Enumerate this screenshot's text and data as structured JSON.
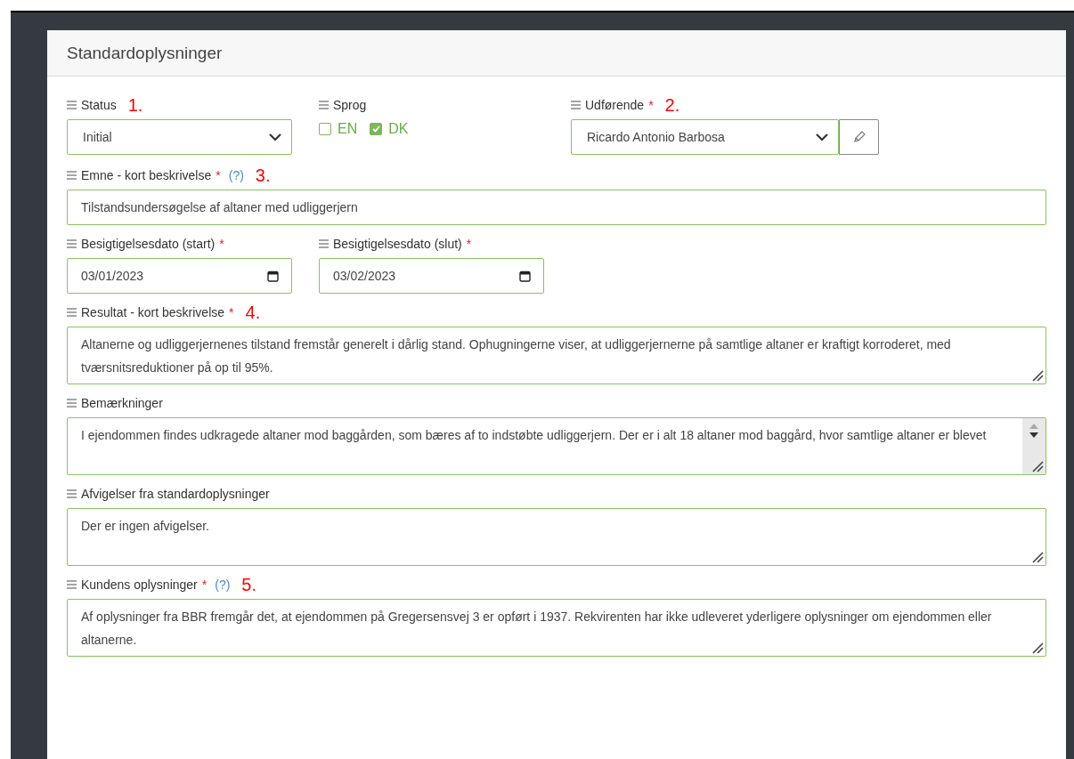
{
  "panel": {
    "title": "Standardoplysninger"
  },
  "rows": [
    {
      "fields": [
        {
          "kind": "select",
          "label": "Status",
          "annotation": "1.",
          "value": "Initial"
        },
        {
          "kind": "checkboxes",
          "label": "Sprog",
          "options": [
            {
              "label": "EN",
              "checked": false
            },
            {
              "label": "DK",
              "checked": true
            }
          ]
        },
        {
          "kind": "select_edit",
          "label": "Udførende",
          "required": true,
          "annotation": "2.",
          "value": "Ricardo Antonio Barbosa"
        }
      ]
    },
    {
      "fields": [
        {
          "kind": "text",
          "label": "Emne - kort beskrivelse",
          "required": true,
          "help": true,
          "annotation": "3.",
          "value": "Tilstandsundersøgelse af altaner med udliggerjern"
        }
      ]
    },
    {
      "fields": [
        {
          "kind": "date",
          "label": "Besigtigelsesdato (start)",
          "required": true,
          "value": "03/01/2023"
        },
        {
          "kind": "date",
          "label": "Besigtigelsesdato (slut)",
          "required": true,
          "value": "03/02/2023"
        }
      ]
    },
    {
      "fields": [
        {
          "kind": "textarea",
          "label": "Resultat - kort beskrivelse",
          "required": true,
          "annotation": "4.",
          "value": "Altanerne og udliggerjernenes tilstand fremstår generelt i dårlig stand. Ophugningerne viser, at udliggerjernerne på samtlige altaner er kraftigt korroderet, med tværsnitsreduktioner på op til 95%."
        }
      ]
    },
    {
      "fields": [
        {
          "kind": "textarea",
          "label": "Bemærkninger",
          "scrollbar": true,
          "value": "I ejendommen findes udkragede altaner mod baggården, som bæres af to indstøbte udliggerjern. Der er i alt 18 altaner mod baggård, hvor samtlige altaner er blevet"
        }
      ]
    },
    {
      "fields": [
        {
          "kind": "textarea",
          "label": "Afvigelser fra standardoplysninger",
          "value": "Der er ingen afvigelser."
        }
      ]
    },
    {
      "fields": [
        {
          "kind": "textarea",
          "label": "Kundens oplysninger",
          "required": true,
          "help": true,
          "annotation": "5.",
          "value": "Af oplysninger fra BBR fremgår det, at ejendommen på Gregersensvej 3 er opført i 1937. Rekvirenten har ikke udleveret yderligere oplysninger om ejendommen eller altanerne."
        }
      ]
    }
  ],
  "marks": {
    "required": "*",
    "help": "(?)"
  }
}
